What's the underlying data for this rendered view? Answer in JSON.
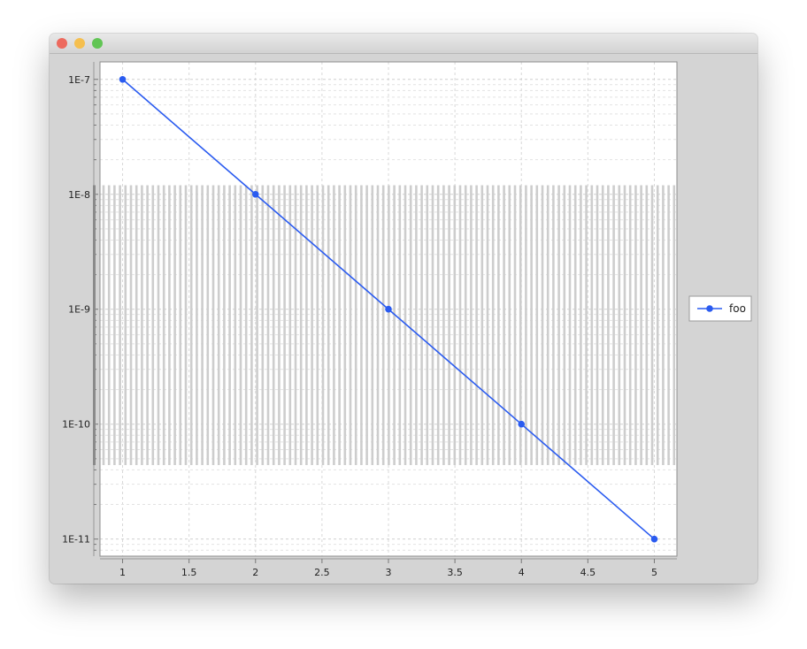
{
  "window": {
    "controls": {
      "close": {
        "icon": "close-icon",
        "color": "#ed6a5e"
      },
      "minimize": {
        "icon": "minimize-icon",
        "color": "#f5bf4f"
      },
      "zoom": {
        "icon": "zoom-icon",
        "color": "#61c554"
      }
    },
    "background": "#d4d4d4"
  },
  "chart_data": {
    "type": "line",
    "x": [
      1,
      2,
      3,
      4,
      5
    ],
    "series": [
      {
        "name": "foo",
        "values": [
          1e-07,
          1e-08,
          1e-09,
          1e-10,
          1e-11
        ],
        "color": "#2a5bf0",
        "marker": "circle"
      }
    ],
    "xlim": [
      0.83,
      5.17
    ],
    "ylim": [
      7.1e-12,
      1.42e-07
    ],
    "yscale": "log",
    "x_ticks": [
      1,
      1.5,
      2,
      2.5,
      3,
      3.5,
      4,
      4.5,
      5
    ],
    "x_tick_labels": [
      "1",
      "1.5",
      "2",
      "2.5",
      "3",
      "3.5",
      "4",
      "4.5",
      "5"
    ],
    "y_ticks": [
      1e-07,
      1e-08,
      1e-09,
      1e-10,
      1e-11
    ],
    "y_tick_labels": [
      "1E-7",
      "1E-8",
      "1E-9",
      "1E-10",
      "1E-11"
    ],
    "grid": true,
    "legend": {
      "placement": "right",
      "entries": [
        "foo"
      ]
    },
    "title": "",
    "xlabel": "",
    "ylabel": ""
  }
}
